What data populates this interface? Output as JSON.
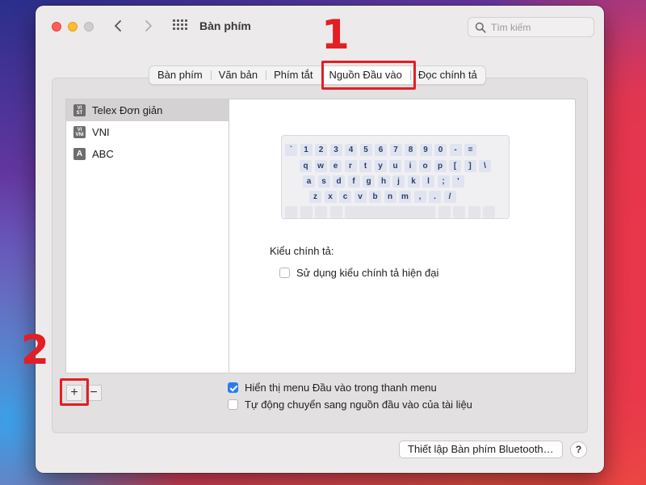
{
  "window": {
    "title": "Bàn phím",
    "search_placeholder": "Tìm kiếm"
  },
  "annotations": {
    "marker1": "1",
    "marker2": "2"
  },
  "tabs": [
    {
      "label": "Bàn phím",
      "active": false
    },
    {
      "label": "Văn bản",
      "active": false
    },
    {
      "label": "Phím tắt",
      "active": false
    },
    {
      "label": "Nguồn Đầu vào",
      "active": true
    },
    {
      "label": "Đọc chính tả",
      "active": false
    }
  ],
  "input_sources": [
    {
      "label": "Telex Đơn giản",
      "icon": "VI ST",
      "selected": true
    },
    {
      "label": "VNI",
      "icon": "VI VNI",
      "selected": false
    },
    {
      "label": "ABC",
      "icon": "A",
      "selected": false
    }
  ],
  "keyboard": {
    "rows": [
      [
        "`",
        "1",
        "2",
        "3",
        "4",
        "5",
        "6",
        "7",
        "8",
        "9",
        "0",
        "-",
        "="
      ],
      [
        "q",
        "w",
        "e",
        "r",
        "t",
        "y",
        "u",
        "i",
        "o",
        "p",
        "[",
        "]",
        "\\"
      ],
      [
        "a",
        "s",
        "d",
        "f",
        "g",
        "h",
        "j",
        "k",
        "l",
        ";",
        "'"
      ],
      [
        "z",
        "x",
        "c",
        "v",
        "b",
        "n",
        "m",
        ",",
        ".",
        "/"
      ]
    ]
  },
  "spelling": {
    "label": "Kiểu chính tả:",
    "modern_option": "Sử dụng kiểu chính tả hiện đại",
    "modern_checked": false
  },
  "options": {
    "show_menu_label": "Hiển thị menu Đầu vào trong thanh menu",
    "show_menu_checked": true,
    "auto_switch_label": "Tự động chuyển sang nguồn đầu vào của tài liệu",
    "auto_switch_checked": false
  },
  "buttons": {
    "add": "+",
    "remove": "−",
    "bluetooth": "Thiết lập Bàn phím Bluetooth…",
    "help": "?"
  },
  "colors": {
    "highlight": "#e31e24",
    "accent": "#2b7cf0"
  }
}
